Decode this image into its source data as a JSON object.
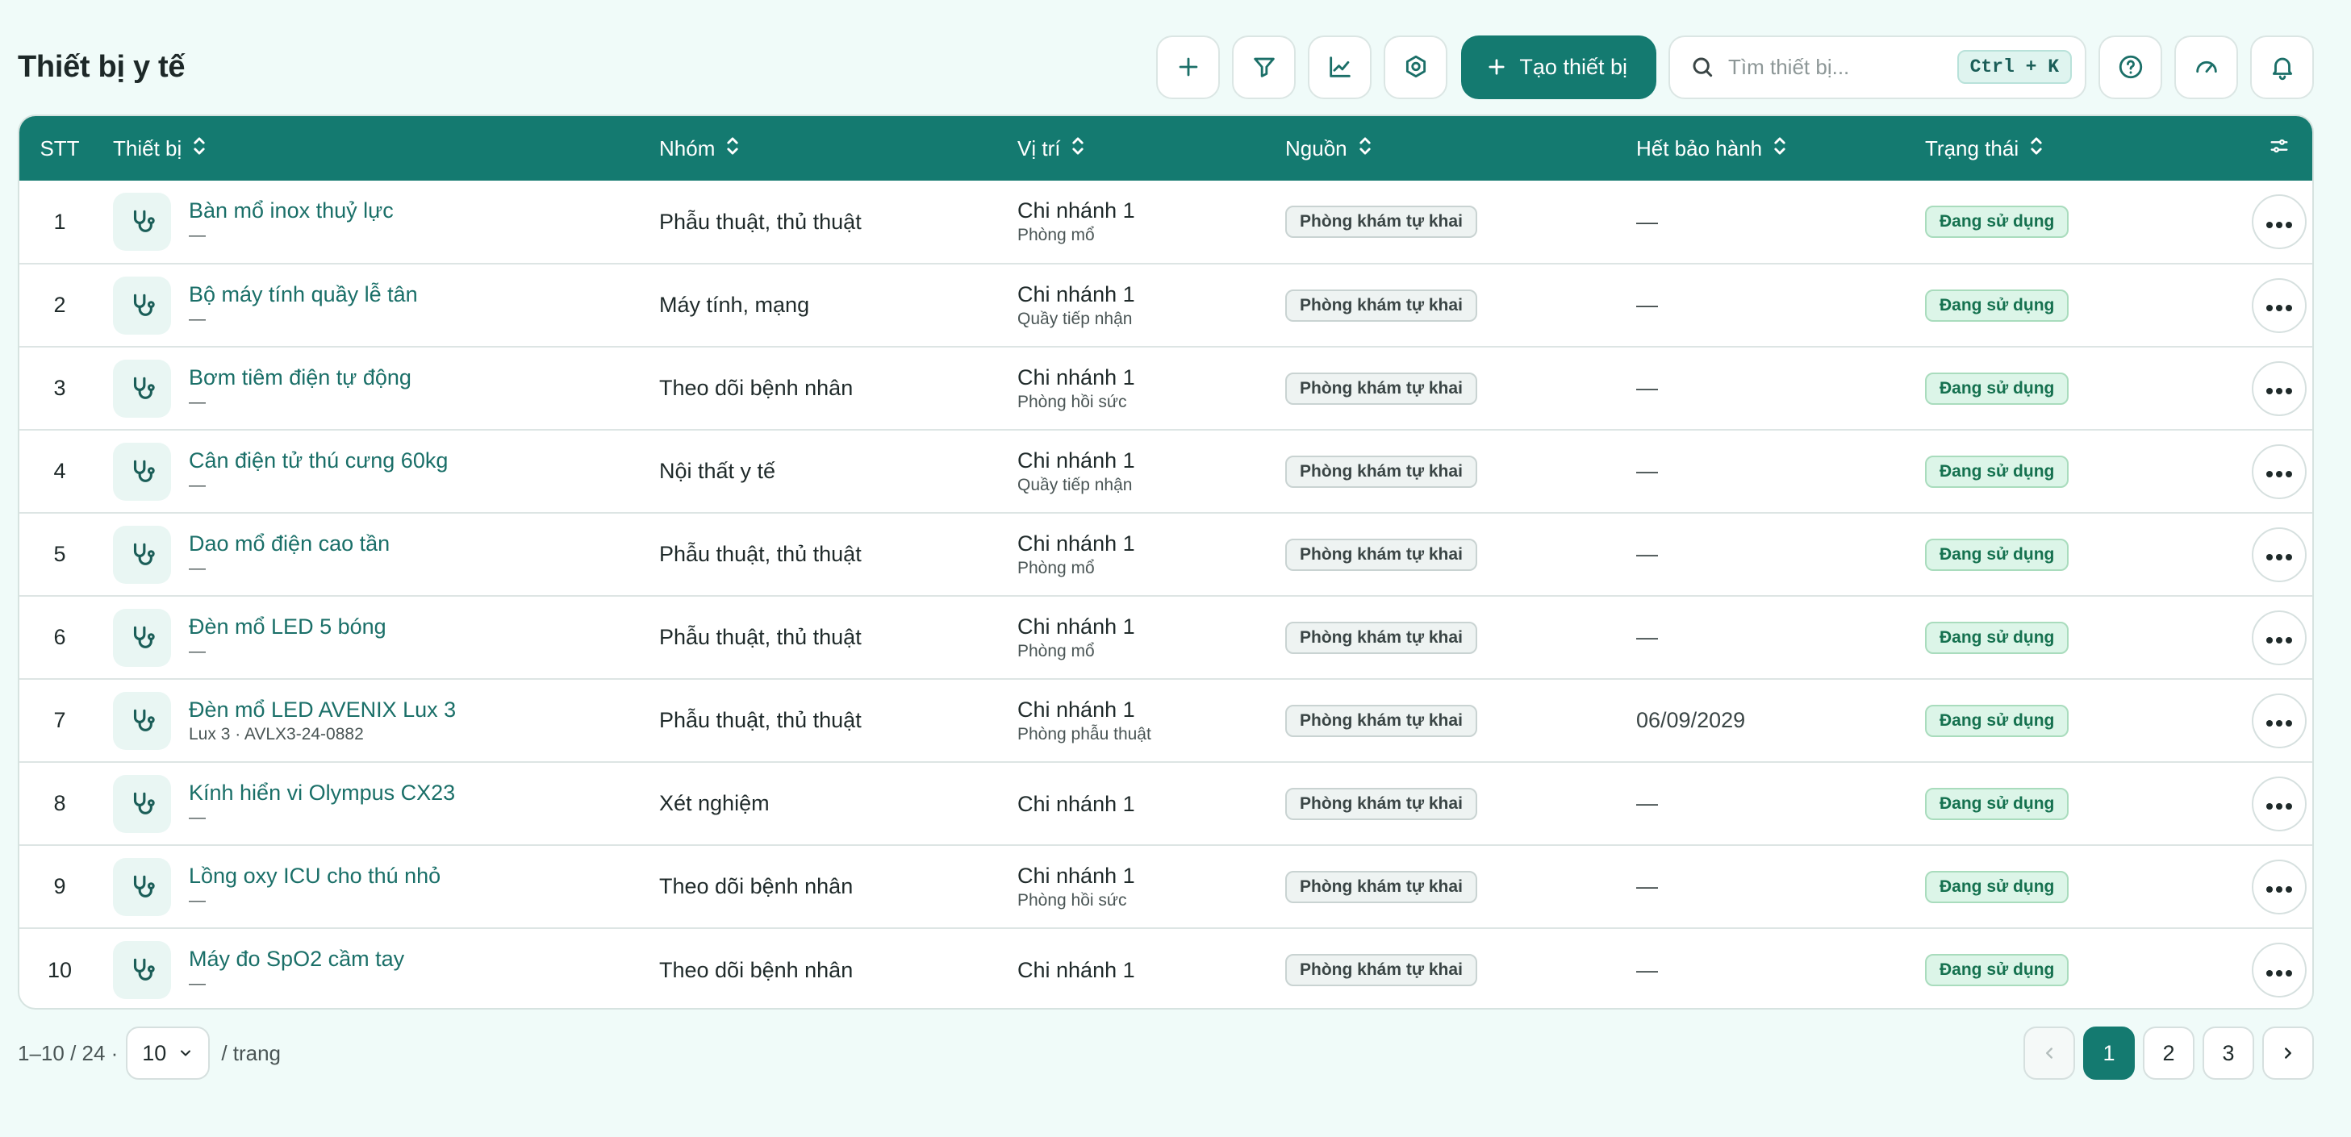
{
  "header": {
    "title": "Thiết bị y tế",
    "create_label": "Tạo thiết bị",
    "search_placeholder": "Tìm thiết bị...",
    "shortcut": "Ctrl + K",
    "icons": [
      "plus-icon",
      "filter-icon",
      "chart-icon",
      "settings-icon",
      "help-icon",
      "gauge-icon",
      "bell-icon"
    ]
  },
  "table": {
    "columns": {
      "stt": "STT",
      "device": "Thiết bị",
      "group": "Nhóm",
      "location": "Vị trí",
      "source": "Nguồn",
      "warranty": "Hết bảo hành",
      "status": "Trạng thái"
    },
    "rows": [
      {
        "stt": "1",
        "name": "Bàn mổ inox thuỷ lực",
        "sub": "—",
        "group": "Phẫu thuật, thủ thuật",
        "branch": "Chi nhánh 1",
        "room": "Phòng mổ",
        "source": "Phòng khám tự khai",
        "warranty": "—",
        "status": "Đang sử dụng"
      },
      {
        "stt": "2",
        "name": "Bộ máy tính quầy lễ tân",
        "sub": "—",
        "group": "Máy tính, mạng",
        "branch": "Chi nhánh 1",
        "room": "Quầy tiếp nhận",
        "source": "Phòng khám tự khai",
        "warranty": "—",
        "status": "Đang sử dụng"
      },
      {
        "stt": "3",
        "name": "Bơm tiêm điện tự động",
        "sub": "—",
        "group": "Theo dõi bệnh nhân",
        "branch": "Chi nhánh 1",
        "room": "Phòng hồi sức",
        "source": "Phòng khám tự khai",
        "warranty": "—",
        "status": "Đang sử dụng"
      },
      {
        "stt": "4",
        "name": "Cân điện tử thú cưng 60kg",
        "sub": "—",
        "group": "Nội thất y tế",
        "branch": "Chi nhánh 1",
        "room": "Quầy tiếp nhận",
        "source": "Phòng khám tự khai",
        "warranty": "—",
        "status": "Đang sử dụng"
      },
      {
        "stt": "5",
        "name": "Dao mổ điện cao tần",
        "sub": "—",
        "group": "Phẫu thuật, thủ thuật",
        "branch": "Chi nhánh 1",
        "room": "Phòng mổ",
        "source": "Phòng khám tự khai",
        "warranty": "—",
        "status": "Đang sử dụng"
      },
      {
        "stt": "6",
        "name": "Đèn mổ LED 5 bóng",
        "sub": "—",
        "group": "Phẫu thuật, thủ thuật",
        "branch": "Chi nhánh 1",
        "room": "Phòng mổ",
        "source": "Phòng khám tự khai",
        "warranty": "—",
        "status": "Đang sử dụng"
      },
      {
        "stt": "7",
        "name": "Đèn mổ LED AVENIX Lux 3",
        "sub": "Lux 3 · AVLX3-24-0882",
        "group": "Phẫu thuật, thủ thuật",
        "branch": "Chi nhánh 1",
        "room": "Phòng phẫu thuật",
        "source": "Phòng khám tự khai",
        "warranty": "06/09/2029",
        "status": "Đang sử dụng"
      },
      {
        "stt": "8",
        "name": "Kính hiển vi Olympus CX23",
        "sub": "—",
        "group": "Xét nghiệm",
        "branch": "Chi nhánh 1",
        "room": "",
        "source": "Phòng khám tự khai",
        "warranty": "—",
        "status": "Đang sử dụng"
      },
      {
        "stt": "9",
        "name": "Lồng oxy ICU cho thú nhỏ",
        "sub": "—",
        "group": "Theo dõi bệnh nhân",
        "branch": "Chi nhánh 1",
        "room": "Phòng hồi sức",
        "source": "Phòng khám tự khai",
        "warranty": "—",
        "status": "Đang sử dụng"
      },
      {
        "stt": "10",
        "name": "Máy đo SpO2 cầm tay",
        "sub": "—",
        "group": "Theo dõi bệnh nhân",
        "branch": "Chi nhánh 1",
        "room": "",
        "source": "Phòng khám tự khai",
        "warranty": "—",
        "status": "Đang sử dụng"
      }
    ]
  },
  "pagination": {
    "range": "1–10 / 24 ·",
    "page_size": "10",
    "per_page_label": "/ trang",
    "pages": [
      "1",
      "2",
      "3"
    ],
    "current_page": "1"
  },
  "colors": {
    "accent": "#147a70",
    "background": "#f0fbf9",
    "status_bg": "#dcf5e8",
    "status_text": "#15714f"
  }
}
